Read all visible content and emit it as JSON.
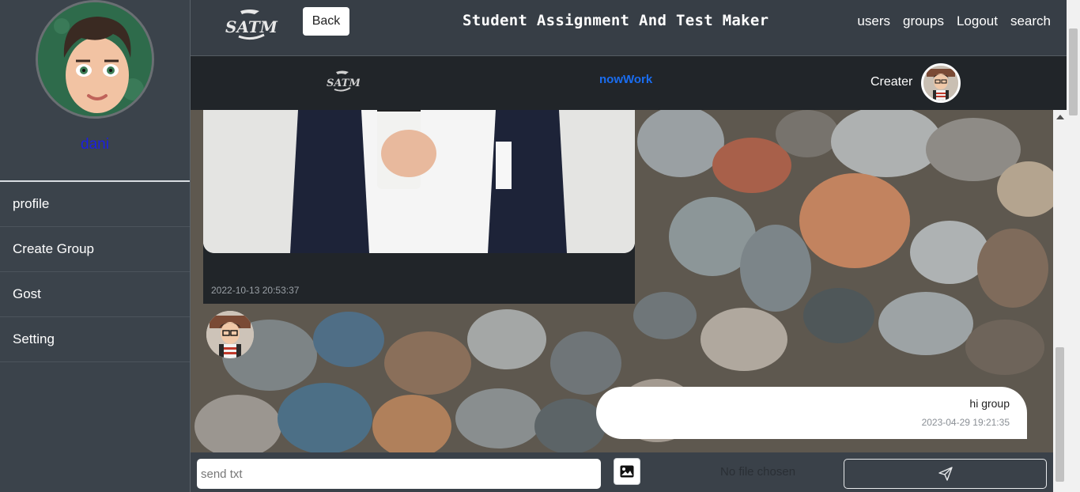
{
  "sidebar": {
    "username": "dani",
    "items": [
      {
        "label": "profile"
      },
      {
        "label": "Create Group"
      },
      {
        "label": "Gost"
      },
      {
        "label": "Setting"
      }
    ]
  },
  "navbar": {
    "logo_text": "SATM",
    "back_label": "Back",
    "title": "Student Assignment And Test Maker",
    "links": [
      {
        "label": "users"
      },
      {
        "label": "groups"
      },
      {
        "label": "Logout"
      },
      {
        "label": "search"
      }
    ]
  },
  "group_header": {
    "group_name": "nowWork",
    "creater_label": "Creater"
  },
  "messages": [
    {
      "type": "image",
      "timestamp": "2022-10-13 20:53:37"
    },
    {
      "type": "text",
      "text": "hi group",
      "timestamp": "2023-04-29 19:21:35"
    }
  ],
  "input_bar": {
    "placeholder": "send txt",
    "file_status": "No file chosen",
    "image_icon": "image-icon",
    "send_icon": "paper-plane-icon"
  },
  "colors": {
    "sidebar_bg": "#3b434b",
    "header_bg": "#212529",
    "group_name": "#1a6df0",
    "username": "#1b20e0"
  }
}
